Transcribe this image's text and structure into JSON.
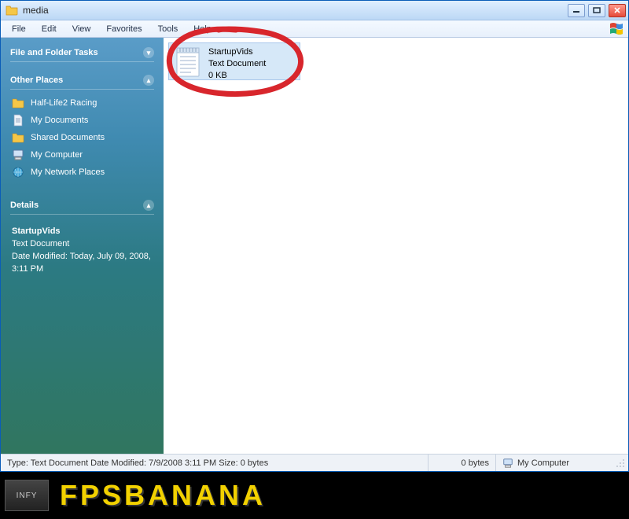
{
  "window": {
    "title": "media"
  },
  "menu": [
    "File",
    "Edit",
    "View",
    "Favorites",
    "Tools",
    "Help"
  ],
  "sidebar": {
    "tasks_header": "File and Folder Tasks",
    "places_header": "Other Places",
    "places": [
      {
        "label": "Half-Life2 Racing",
        "icon": "folder"
      },
      {
        "label": "My Documents",
        "icon": "doc"
      },
      {
        "label": "Shared Documents",
        "icon": "folder"
      },
      {
        "label": "My Computer",
        "icon": "computer"
      },
      {
        "label": "My Network Places",
        "icon": "network"
      }
    ],
    "details_header": "Details",
    "details": {
      "name": "StartupVids",
      "type": "Text Document",
      "modified_label": "Date Modified: Today, July 09, 2008, 3:11 PM"
    }
  },
  "file": {
    "name": "StartupVids",
    "type": "Text Document",
    "size": "0 KB"
  },
  "status": {
    "left": "Type: Text Document Date Modified: 7/9/2008 3:11 PM Size: 0 bytes",
    "bytes": "0 bytes",
    "location": "My Computer"
  },
  "footer": {
    "badge": "INFY",
    "brand": "FPSBANANA"
  }
}
